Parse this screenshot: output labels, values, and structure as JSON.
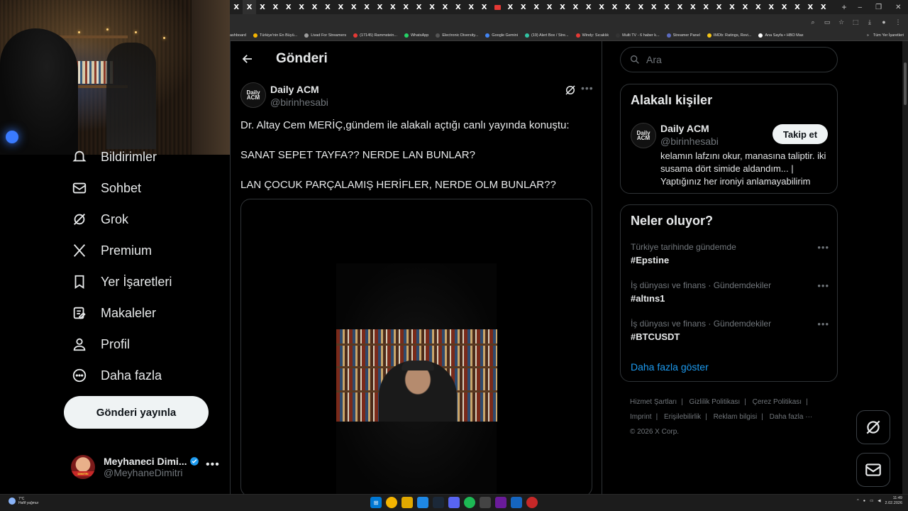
{
  "browser": {
    "tabs_count": 46,
    "tab_glyph": "X",
    "bookmarks": [
      {
        "label": "ashboard",
        "color": "#888888"
      },
      {
        "label": "Türkiye'nin En Büyü...",
        "color": "#f4b400"
      },
      {
        "label": "Livad For Streamers",
        "color": "#9e9e9e"
      },
      {
        "label": "(17145) Rammstein...",
        "color": "#e53935"
      },
      {
        "label": "WhatsApp",
        "color": "#25d366"
      },
      {
        "label": "Electronic Diversity...",
        "color": "#555555"
      },
      {
        "label": "Google Gemini",
        "color": "#4285f4"
      },
      {
        "label": "(19) Alert Box / Stre...",
        "color": "#31c3a2"
      },
      {
        "label": "Windy: Sıcaklık",
        "color": "#e53935"
      },
      {
        "label": "Multi TV - 6 haber k...",
        "color": "#333333"
      },
      {
        "label": "Streamer Panel",
        "color": "#5c6bc0"
      },
      {
        "label": "IMDb: Ratings, Revi...",
        "color": "#f5c518"
      },
      {
        "label": "Ana Sayfa • HBO Max",
        "color": "#ffffff"
      }
    ],
    "bookmarks_all": "Tüm Yer İşaretleri"
  },
  "nav": {
    "items": [
      {
        "label": "Bildirimler",
        "icon": "bell-icon"
      },
      {
        "label": "Sohbet",
        "icon": "envelope-icon"
      },
      {
        "label": "Grok",
        "icon": "grok-icon"
      },
      {
        "label": "Premium",
        "icon": "x-logo-icon"
      },
      {
        "label": "Yer İşaretleri",
        "icon": "bookmark-icon"
      },
      {
        "label": "Makaleler",
        "icon": "article-icon"
      },
      {
        "label": "Profil",
        "icon": "profile-icon"
      },
      {
        "label": "Daha fazla",
        "icon": "more-circle-icon"
      }
    ],
    "post_button": "Gönderi yayınla",
    "account": {
      "name": "Meyhaneci Dimi...",
      "handle": "@MeyhaneDimitri",
      "avatar_band": "DIMITRI"
    }
  },
  "main": {
    "title": "Gönderi",
    "post": {
      "author": "Daily ACM",
      "handle": "@birinhesabi",
      "avatar_text": "Daily ACM",
      "lines": [
        "Dr. Altay Cem MERİÇ,gündem ile alakalı açtığı canlı yayında konuştu:",
        "SANAT SEPET TAYFA?? NERDE LAN BUNLAR?",
        "LAN ÇOCUK PARÇALAMIŞ HERİFLER, NERDE OLM BUNLAR??"
      ]
    }
  },
  "right": {
    "search_placeholder": "Ara",
    "related": {
      "title": "Alakalı kişiler",
      "name": "Daily ACM",
      "handle": "@birinhesabi",
      "bio": "kelamın lafzını okur, manasına taliptir. iki susama dört simide aldandım... | Yaptığınız her ironiyi anlamayabilirim",
      "follow": "Takip et"
    },
    "trends": {
      "title": "Neler oluyor?",
      "items": [
        {
          "category": "Türkiye tarihinde gündemde",
          "tag": "#Epstine"
        },
        {
          "category": "İş dünyası ve finans · Gündemdekiler",
          "tag": "#altıns1"
        },
        {
          "category": "İş dünyası ve finans · Gündemdekiler",
          "tag": "#BTCUSDT"
        }
      ],
      "show_more": "Daha fazla göster"
    },
    "footer": {
      "links": [
        "Hizmet Şartları",
        "Gizlilik Politikası",
        "Çerez Politikası",
        "Imprint",
        "Erişilebilirlik",
        "Reklam bilgisi",
        "Daha fazla ···"
      ],
      "copyright": "© 2026 X Corp."
    }
  },
  "taskbar": {
    "temp": "7°C",
    "weather": "Hafif yağmur",
    "time": "11:49",
    "date": "2.02.2026"
  }
}
